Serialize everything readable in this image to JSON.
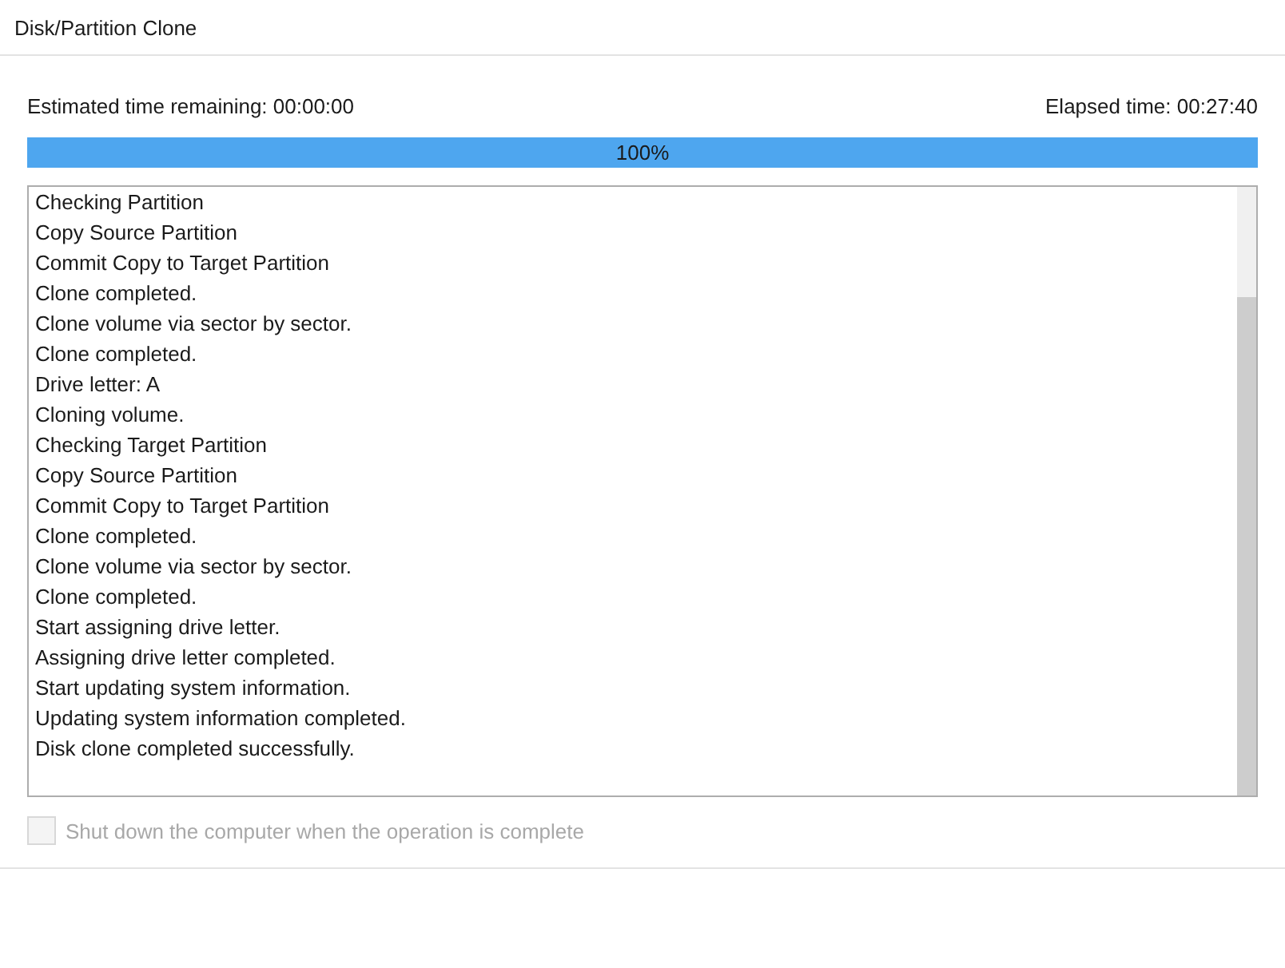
{
  "window": {
    "title": "Disk/Partition Clone"
  },
  "estimated": "Estimated time remaining: 00:00:00",
  "elapsed": "Elapsed time: 00:27:40",
  "progress": {
    "level": 1,
    "label": "100%"
  },
  "log": [
    "Checking Partition",
    "Copy Source Partition",
    "Commit Copy to Target Partition",
    "Clone completed.",
    "Clone volume via sector by sector.",
    "Clone completed.",
    "Drive letter: A",
    "Cloning volume.",
    "Checking Target Partition",
    "Copy Source Partition",
    "Commit Copy to Target Partition",
    "Clone completed.",
    "Clone volume via sector by sector.",
    "Clone completed.",
    "Start assigning drive letter.",
    "Assigning drive letter completed.",
    "Start updating system information.",
    "Updating system information completed.",
    "Disk clone completed successfully."
  ],
  "shutdown": {
    "label": "Shut down the computer when the operation is complete",
    "checked": false,
    "disabled": true
  }
}
